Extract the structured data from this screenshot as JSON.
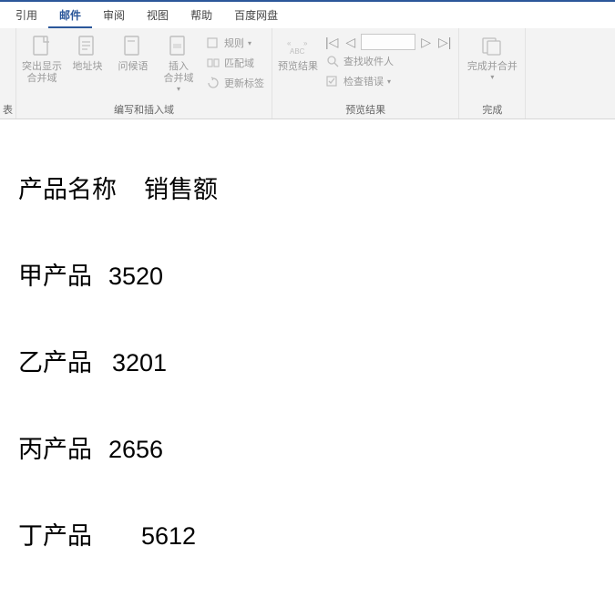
{
  "tabs": {
    "cite": "引用",
    "mail": "邮件",
    "review": "审阅",
    "view": "视图",
    "help": "帮助",
    "baidu": "百度网盘"
  },
  "group1": {
    "label": "表",
    "highlight": "突出显示\n合并域",
    "address": "地址块",
    "greeting": "问候语",
    "insert": "插入\n合并域",
    "rules": "规则",
    "match": "匹配域",
    "update": "更新标签",
    "title": "编写和插入域"
  },
  "group2": {
    "preview": "预览结果",
    "find": "查找收件人",
    "check": "检查错误",
    "title": "预览结果"
  },
  "group3": {
    "finish": "完成并合并",
    "title": "完成"
  },
  "doc": {
    "h1": "产品名称",
    "h2": "销售额",
    "r1a": "甲产品",
    "r1b": "3520",
    "r2a": "乙产品",
    "r2b": "3201",
    "r3a": "丙产品",
    "r3b": "2656",
    "r4a": "丁产品",
    "r4b": "5612"
  }
}
